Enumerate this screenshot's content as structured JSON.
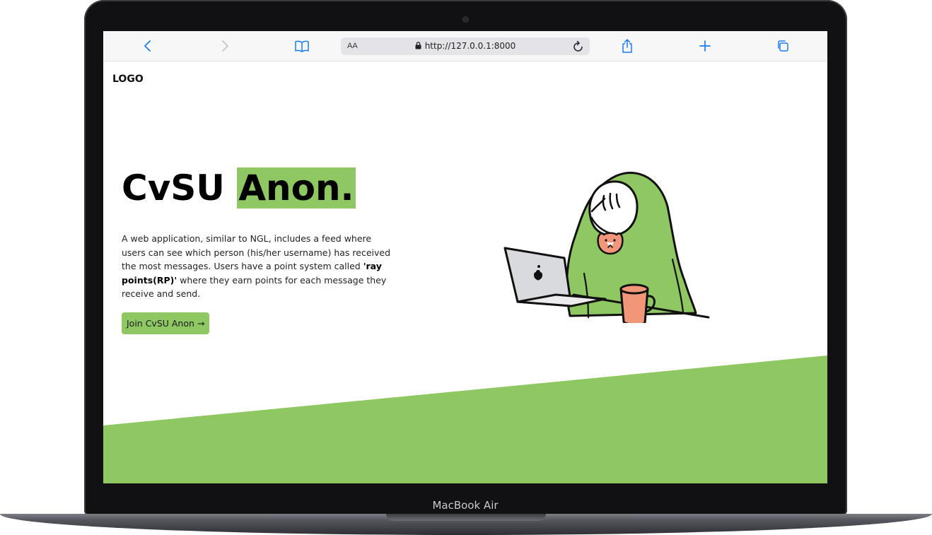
{
  "device": {
    "label": "MacBook Air"
  },
  "browser": {
    "text_size_label": "AA",
    "url": "http://127.0.0.1:8000"
  },
  "page": {
    "logo": "LOGO",
    "title_plain": "CvSU ",
    "title_highlight": "Anon.",
    "description_before": "A web application, similar to NGL, includes a feed where users can see which person (his/her username) has received the most messages. Users have a point system called ",
    "description_bold": "'ray points(RP)'",
    "description_after": " where they earn points for each message they receive and send.",
    "cta_label": "Join CvSU Anon →"
  },
  "colors": {
    "accent_green": "#8fc862",
    "browser_blue": "#1a7cf5",
    "mug_orange": "#f2967a"
  },
  "icons": [
    "back-icon",
    "forward-icon",
    "bookmarks-icon",
    "lock-icon",
    "reload-icon",
    "share-icon",
    "new-tab-icon",
    "tabs-icon"
  ]
}
